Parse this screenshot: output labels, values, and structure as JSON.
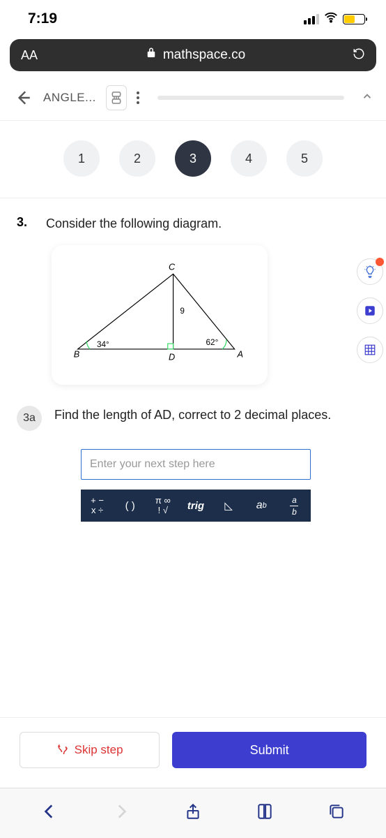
{
  "status": {
    "time": "7:19"
  },
  "url_bar": {
    "aa": "AA",
    "domain": "mathspace.co"
  },
  "header": {
    "breadcrumb": "ANGLE..."
  },
  "steps": [
    {
      "label": "1",
      "active": false
    },
    {
      "label": "2",
      "active": false
    },
    {
      "label": "3",
      "active": true
    },
    {
      "label": "4",
      "active": false
    },
    {
      "label": "5",
      "active": false
    }
  ],
  "question": {
    "number": "3.",
    "prompt": "Consider the following diagram.",
    "diagram": {
      "vertex_B": "B",
      "vertex_C": "C",
      "vertex_D": "D",
      "vertex_A": "A",
      "side_CD": "9",
      "angle_B": "34°",
      "angle_A": "62°"
    },
    "part_label": "3a",
    "part_text_pre": "Find the length of ",
    "part_math": "AD",
    "part_text_post": ", correct to 2 decimal places."
  },
  "input": {
    "placeholder": "Enter your next step here"
  },
  "toolbar": {
    "ops": "+ −\nx ÷",
    "paren": "( )",
    "consts": "π ∞\n! √",
    "trig": "trig",
    "tri": "◺",
    "pow_base": "a",
    "pow_exp": "b",
    "frac_num": "a",
    "frac_den": "b"
  },
  "actions": {
    "skip": "Skip step",
    "submit": "Submit"
  }
}
